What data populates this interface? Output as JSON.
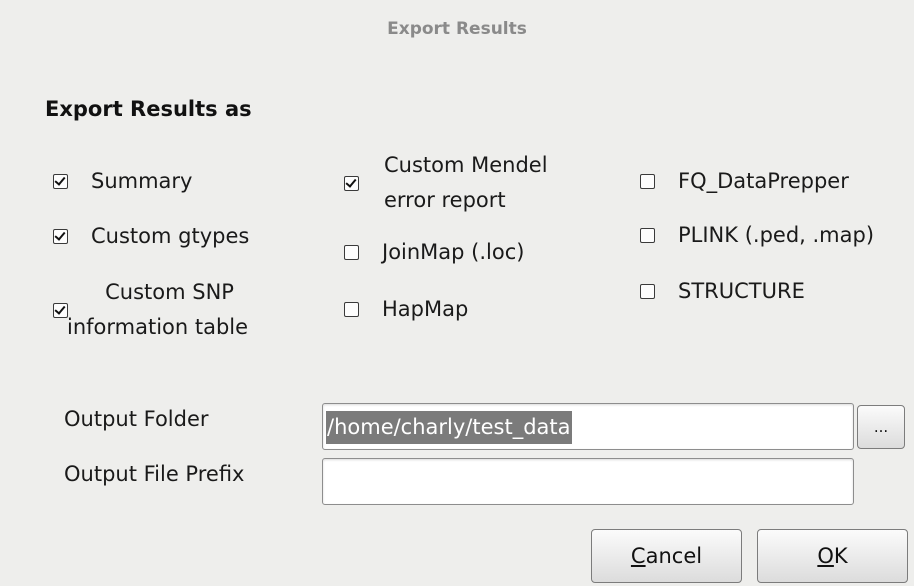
{
  "window": {
    "title": "Export Results"
  },
  "section": {
    "heading": "Export Results as"
  },
  "options": {
    "summary": {
      "label": "Summary",
      "checked": true
    },
    "custom_gtypes": {
      "label": "Custom gtypes",
      "checked": true
    },
    "custom_snp_line1": "Custom SNP",
    "custom_snp_line2": "information table",
    "custom_snp_checked": true,
    "custom_mendel_line1": "Custom Mendel",
    "custom_mendel_line2": "error report",
    "custom_mendel_checked": true,
    "joinmap": {
      "label": "JoinMap (.loc)",
      "checked": false
    },
    "hapmap": {
      "label": "HapMap",
      "checked": false
    },
    "fq_dataprepper": {
      "label": "FQ_DataPrepper",
      "checked": false
    },
    "plink": {
      "label": "PLINK (.ped, .map)",
      "checked": false
    },
    "structure": {
      "label": "STRUCTURE",
      "checked": false
    }
  },
  "output": {
    "folder_label": "Output Folder",
    "folder_value": "/home/charly/test_data",
    "browse_label": "...",
    "prefix_label": "Output File Prefix",
    "prefix_value": ""
  },
  "buttons": {
    "cancel_mnemonic": "C",
    "cancel_rest": "ancel",
    "ok_mnemonic": "O",
    "ok_rest": "K"
  }
}
